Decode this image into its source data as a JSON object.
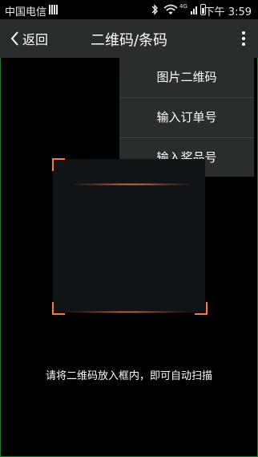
{
  "status_bar": {
    "carrier": "中国电信",
    "network_type": "4G",
    "time_prefix": "下午",
    "time": "3:59"
  },
  "header": {
    "back_label": "返回",
    "title": "二维码/条码",
    "more_icon": "more-vertical-icon"
  },
  "menu": {
    "items": [
      {
        "label": "图片二维码"
      },
      {
        "label": "输入订单号"
      },
      {
        "label": "输入奖品号"
      }
    ]
  },
  "scanner": {
    "hint": "请将二维码放入框内，即可自动扫描",
    "corner_color": "#ff7a3a"
  },
  "colors": {
    "bar_background": "#2a2d2e",
    "page_background": "#000000"
  }
}
